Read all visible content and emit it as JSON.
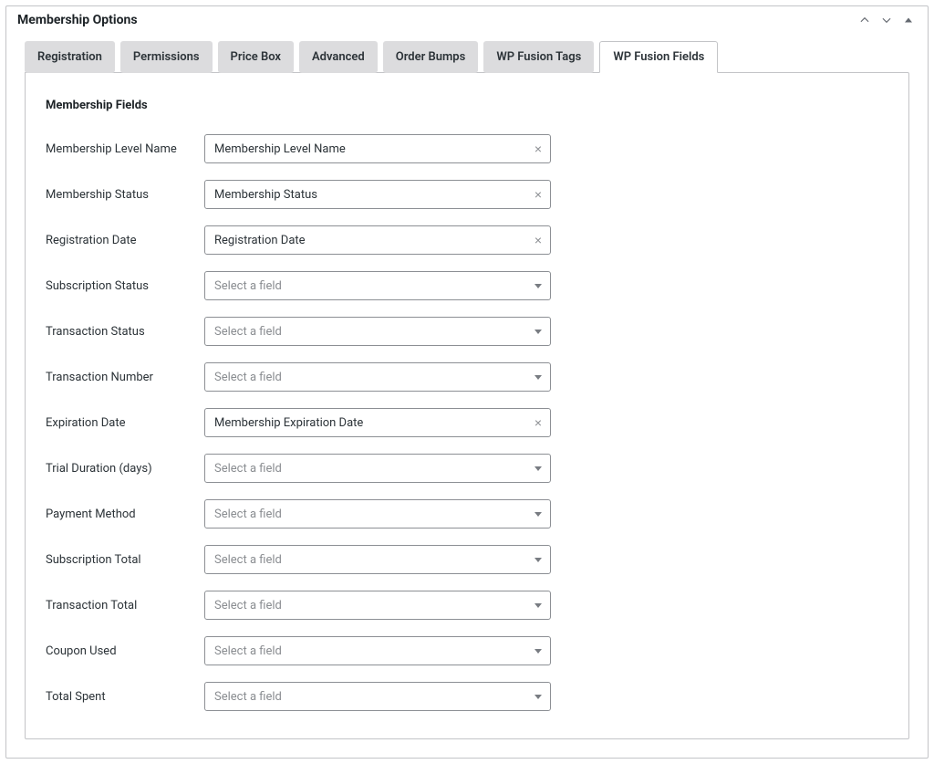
{
  "header": {
    "title": "Membership Options"
  },
  "tabs": [
    {
      "label": "Registration"
    },
    {
      "label": "Permissions"
    },
    {
      "label": "Price Box"
    },
    {
      "label": "Advanced"
    },
    {
      "label": "Order Bumps"
    },
    {
      "label": "WP Fusion Tags"
    },
    {
      "label": "WP Fusion Fields"
    }
  ],
  "panel": {
    "section_title": "Membership Fields",
    "placeholder": "Select a field",
    "fields": [
      {
        "label": "Membership Level Name",
        "value": "Membership Level Name"
      },
      {
        "label": "Membership Status",
        "value": "Membership Status"
      },
      {
        "label": "Registration Date",
        "value": "Registration Date"
      },
      {
        "label": "Subscription Status",
        "value": null
      },
      {
        "label": "Transaction Status",
        "value": null
      },
      {
        "label": "Transaction Number",
        "value": null
      },
      {
        "label": "Expiration Date",
        "value": "Membership Expiration Date"
      },
      {
        "label": "Trial Duration (days)",
        "value": null
      },
      {
        "label": "Payment Method",
        "value": null
      },
      {
        "label": "Subscription Total",
        "value": null
      },
      {
        "label": "Transaction Total",
        "value": null
      },
      {
        "label": "Coupon Used",
        "value": null
      },
      {
        "label": "Total Spent",
        "value": null
      }
    ]
  }
}
